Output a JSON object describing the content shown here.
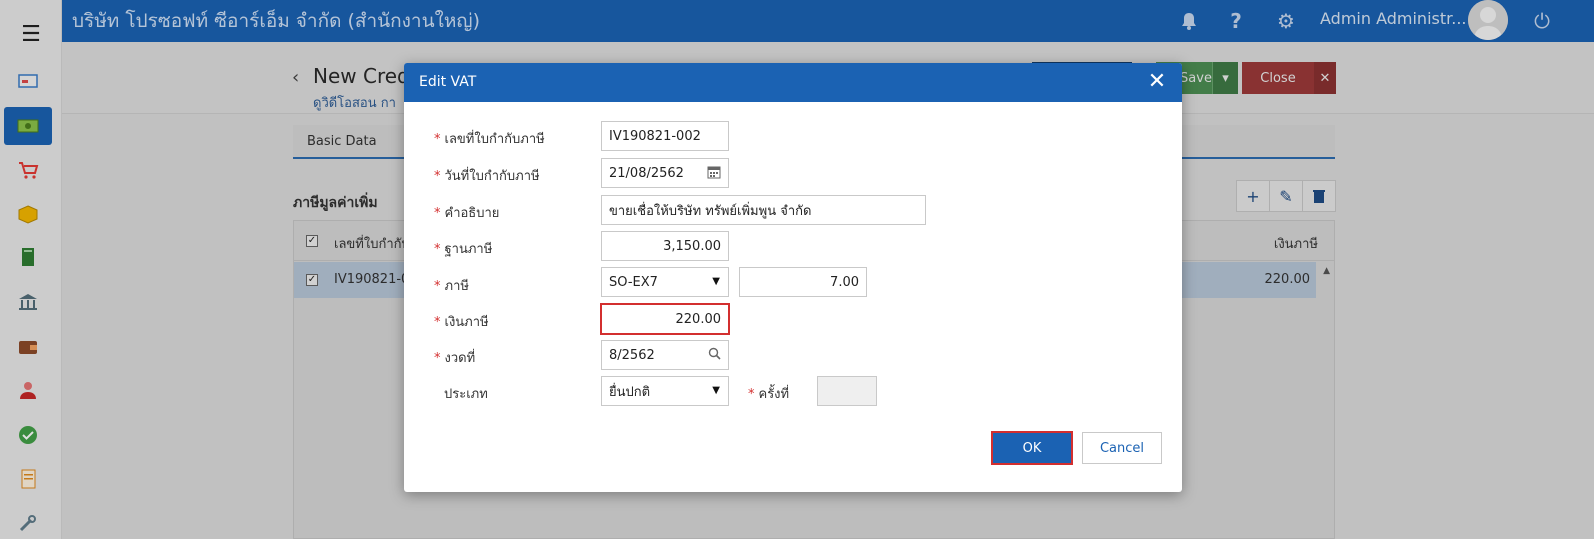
{
  "topbar": {
    "company": "บริษัท โปรซอฟท์ ซีอาร์เอ็ม จำกัด (สำนักงานใหญ่)",
    "user_name": "Admin Administr...",
    "icons": [
      "bell-icon",
      "help-icon",
      "gear-icon",
      "avatar",
      "power-icon"
    ]
  },
  "sidebar": {
    "items": [
      "dashboard-icon",
      "money-icon",
      "cart-icon",
      "box-icon",
      "book-icon",
      "bank-icon",
      "wallet-icon",
      "person-icon",
      "check-icon",
      "document-icon",
      "tools-icon"
    ]
  },
  "page": {
    "title": "New Cred",
    "subtitle": "ดูวิดีโอสอน กา",
    "save_label": "Save",
    "close_label": "Close",
    "tab_basic": "Basic Data",
    "section_title": "ภาษีมูลค่าเพิ่ม",
    "grid": {
      "col_invoice": "เลขที่ใบกำกับ",
      "col_tax": "เงินภาษี",
      "row_invoice": "IV190821-0",
      "row_tax": "220.00"
    }
  },
  "modal": {
    "title": "Edit VAT",
    "fields": {
      "invoice_no_label": "เลขที่ใบกำกับภาษี",
      "invoice_no_value": "IV190821-002",
      "invoice_date_label": "วันที่ใบกำกับภาษี",
      "invoice_date_value": "21/08/2562",
      "description_label": "คำอธิบาย",
      "description_value": "ขายเชื่อให้บริษัท ทรัพย์เพิ่มพูน จำกัด",
      "tax_base_label": "ฐานภาษี",
      "tax_base_value": "3,150.00",
      "tax_label": "ภาษี",
      "tax_code_value": "SO-EX7",
      "tax_rate_value": "7.00",
      "tax_amount_label": "เงินภาษี",
      "tax_amount_value": "220.00",
      "period_label": "งวดที่",
      "period_value": "8/2562",
      "type_label": "ประเภท",
      "type_value": "ยื่นปกติ",
      "times_label": "ครั้งที่",
      "times_value": ""
    },
    "ok_label": "OK",
    "cancel_label": "Cancel"
  },
  "colors": {
    "primary": "#1b62b3",
    "error": "#d32f2f"
  }
}
